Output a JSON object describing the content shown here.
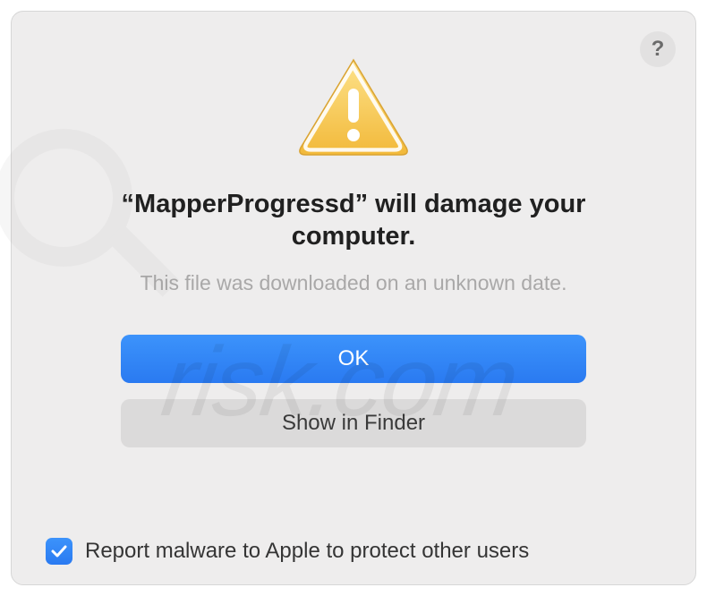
{
  "dialog": {
    "title": "“MapperProgressd” will damage your computer.",
    "subtitle": "This file was downloaded on an unknown date.",
    "helpButton": "?",
    "buttons": {
      "primary": "OK",
      "secondary": "Show in Finder"
    },
    "checkbox": {
      "checked": true,
      "label": "Report malware to Apple to protect other users"
    }
  }
}
